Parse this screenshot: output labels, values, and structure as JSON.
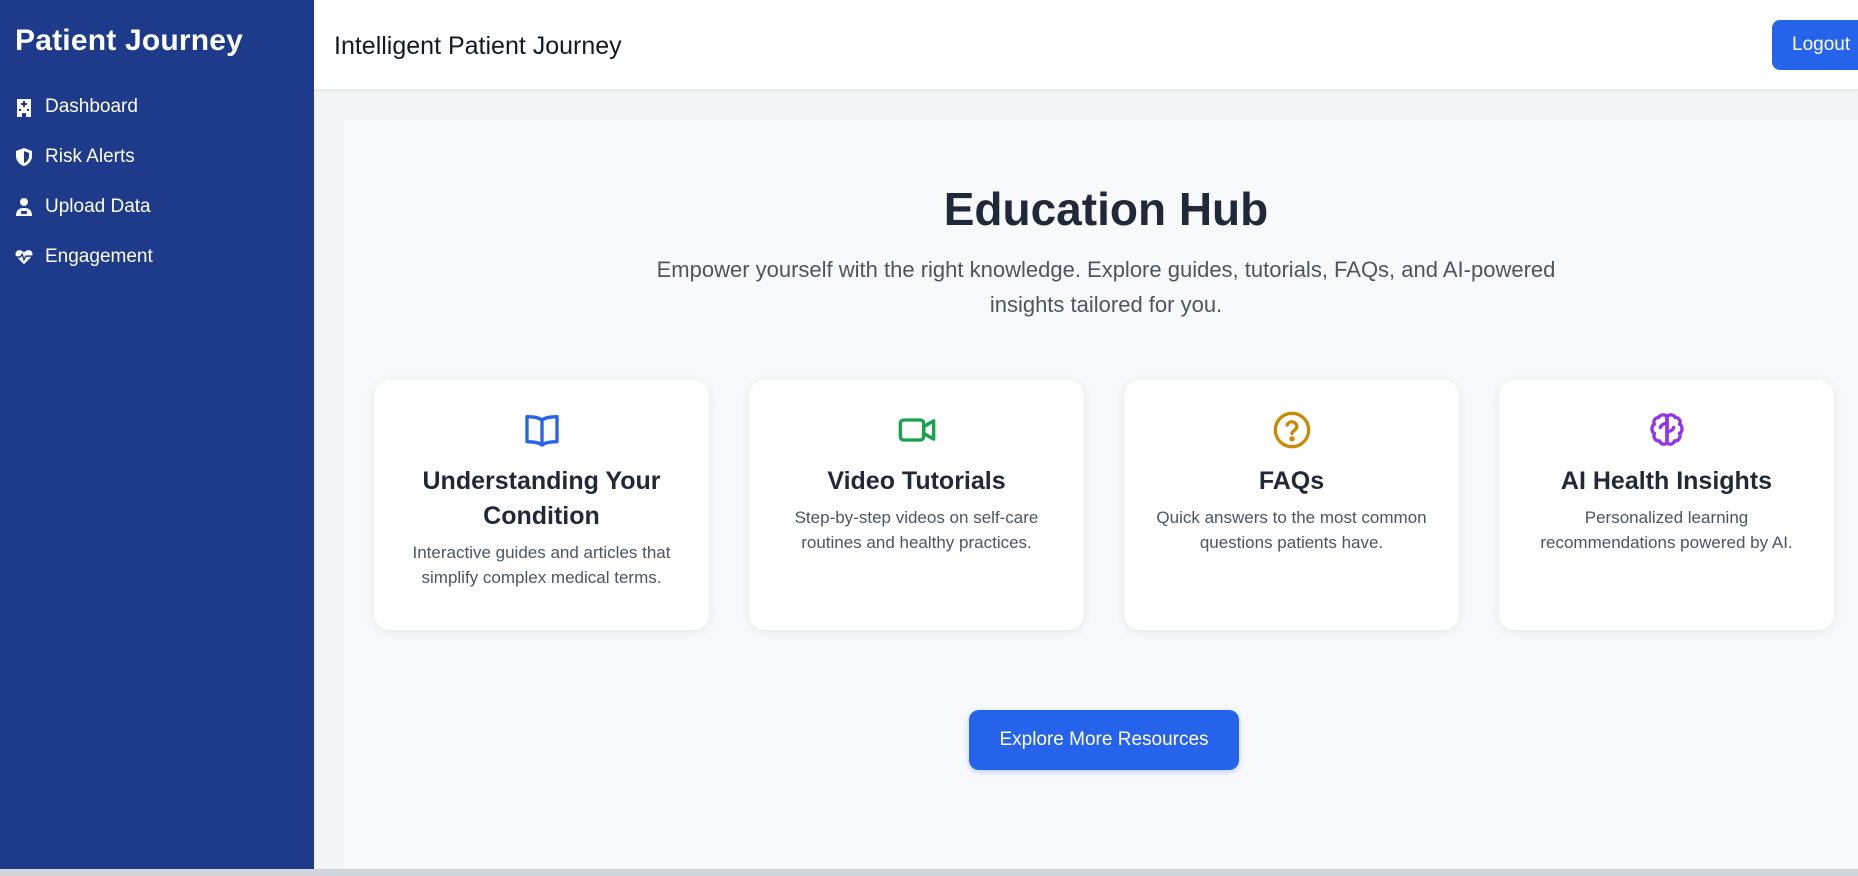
{
  "sidebar": {
    "brand": "Patient Journey",
    "items": [
      {
        "label": "Dashboard",
        "icon": "hospital-icon"
      },
      {
        "label": "Risk Alerts",
        "icon": "shield-icon"
      },
      {
        "label": "Upload Data",
        "icon": "user-doctor-icon"
      },
      {
        "label": "Engagement",
        "icon": "heart-pulse-icon"
      }
    ]
  },
  "header": {
    "title": "Intelligent Patient Journey",
    "logout_label": "Logout"
  },
  "hub": {
    "title": "Education Hub",
    "subtitle": "Empower yourself with the right knowledge. Explore guides, tutorials, FAQs, and AI-powered insights tailored for you.",
    "cards": [
      {
        "title": "Understanding Your Condition",
        "description": "Interactive guides and articles that simplify complex medical terms.",
        "icon": "book-icon",
        "color": "#2563eb"
      },
      {
        "title": "Video Tutorials",
        "description": "Step-by-step videos on self-care routines and healthy practices.",
        "icon": "video-icon",
        "color": "#16a34a"
      },
      {
        "title": "FAQs",
        "description": "Quick answers to the most common questions patients have.",
        "icon": "question-circle-icon",
        "color": "#ca8a04"
      },
      {
        "title": "AI Health Insights",
        "description": "Personalized learning recommendations powered by AI.",
        "icon": "brain-icon",
        "color": "#9333ea"
      }
    ],
    "explore_label": "Explore More Resources"
  },
  "colors": {
    "sidebar": "#1e3a8a",
    "primary": "#2563eb"
  }
}
